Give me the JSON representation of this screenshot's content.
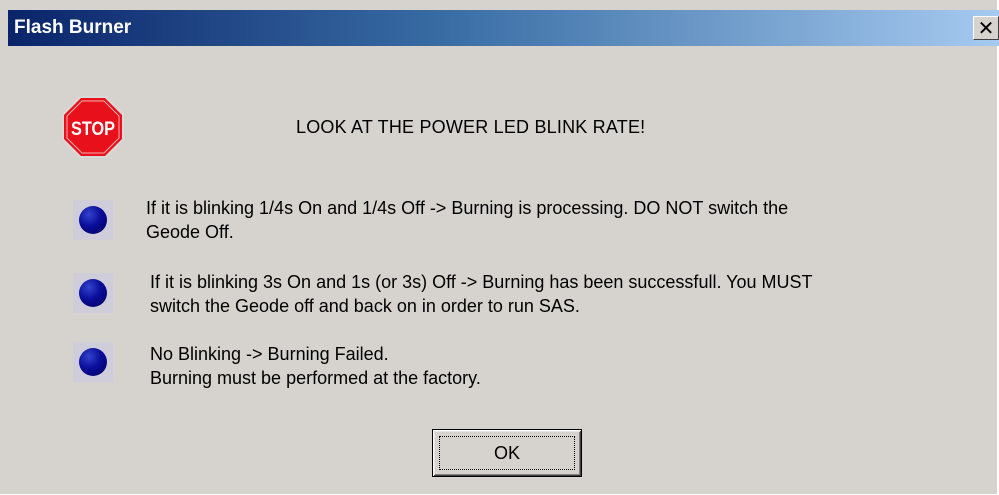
{
  "window": {
    "title": "Flash Burner",
    "close_glyph": "✕"
  },
  "stop_icon": {
    "name": "stop-sign-icon",
    "label": "STOP",
    "color": "#e8101a"
  },
  "headline": "LOOK AT THE POWER LED BLINK RATE!",
  "messages": [
    {
      "icon": "blue-led-icon",
      "text": "If it is blinking 1/4s On and 1/4s Off -> Burning is processing. DO NOT switch the\nGeode Off."
    },
    {
      "icon": "blue-led-icon",
      "text": "If it is blinking 3s On and 1s (or 3s) Off -> Burning has been successfull. You MUST\nswitch the Geode off and back on in order to run SAS."
    },
    {
      "icon": "blue-led-icon",
      "text": "No Blinking -> Burning Failed.\nBurning must be performed at the factory."
    }
  ],
  "buttons": {
    "ok_label": "OK"
  },
  "colors": {
    "titlebar_start": "#0a246a",
    "titlebar_end": "#a6caf0",
    "dialog_bg": "#d6d3ce",
    "led_blue": "#0a0d9a"
  }
}
